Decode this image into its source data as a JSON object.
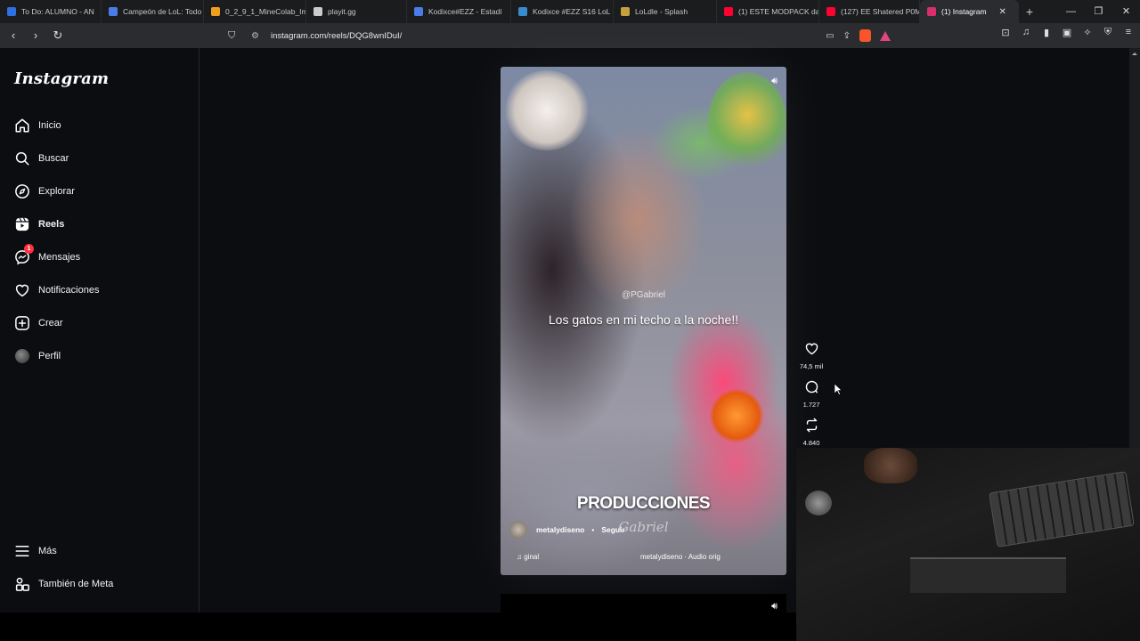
{
  "browser": {
    "tabs": [
      {
        "label": "To Do: ALUMNO - AN",
        "color": "#2f6fe0"
      },
      {
        "label": "Campeón de LoL: Todo",
        "color": "#4a7be8"
      },
      {
        "label": "0_2_9_1_MineColab_Im",
        "color": "#f0a020"
      },
      {
        "label": "playit.gg",
        "color": "#cccccc"
      },
      {
        "label": "Kodixce#EZZ - Estadí",
        "color": "#4a7be8"
      },
      {
        "label": "Kodixce #EZZ S16 LoL",
        "color": "#3a8ad0"
      },
      {
        "label": "LoLdle - Splash",
        "color": "#c8a040"
      },
      {
        "label": "(1) ESTE MODPACK da",
        "color": "#ff0033"
      },
      {
        "label": "(127) EE Shatered P0M",
        "color": "#ff0033"
      },
      {
        "label": "(1) Instagram",
        "color": "#d6306b",
        "active": true
      }
    ],
    "url": "instagram.com/reels/DQG8wnIDuI/",
    "new_tab": "+",
    "window_controls": [
      "—",
      "❐",
      "✕"
    ]
  },
  "sidebar": {
    "logo": "Instagram",
    "items": [
      {
        "label": "Inicio",
        "icon": "home-icon"
      },
      {
        "label": "Buscar",
        "icon": "search-icon"
      },
      {
        "label": "Explorar",
        "icon": "compass-icon"
      },
      {
        "label": "Reels",
        "icon": "reels-icon"
      },
      {
        "label": "Mensajes",
        "icon": "messenger-icon",
        "badge": "1"
      },
      {
        "label": "Notificaciones",
        "icon": "heart-icon"
      },
      {
        "label": "Crear",
        "icon": "plus-square-icon"
      },
      {
        "label": "Perfil",
        "icon": "avatar"
      }
    ],
    "more": "Más",
    "meta": "También de Meta"
  },
  "reel": {
    "watermark": "@PGabriel",
    "caption": "Los gatos en mi techo a la noche!!",
    "overlay_title": "PRODUCCIONES",
    "overlay_sub": "Gabriel",
    "author": "metalydiseno",
    "follow": "Seguir",
    "audio_left": "♫ ginal",
    "audio_right": "metalydiseno · Audio orig"
  },
  "actions": {
    "likes": "74,5 mil",
    "comments": "1.727",
    "shares": "4.840"
  }
}
